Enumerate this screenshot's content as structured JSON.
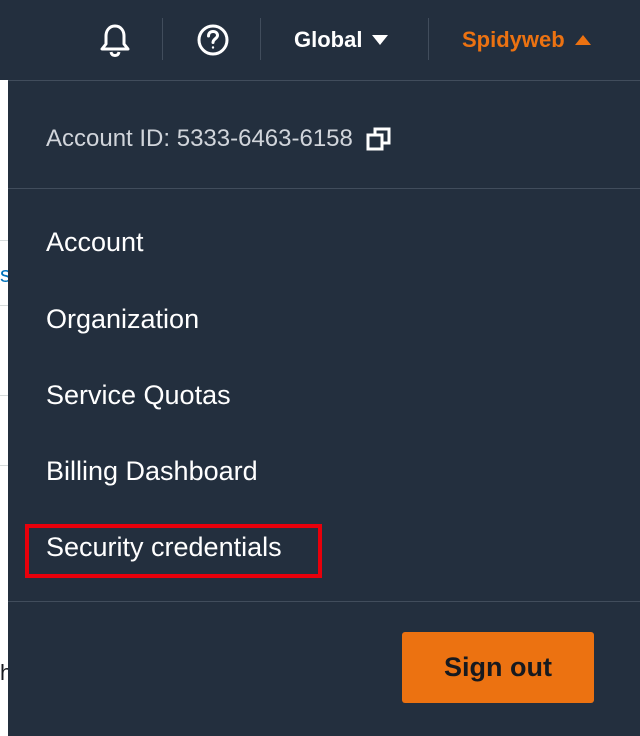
{
  "background": {
    "fragments": [
      "s",
      "h"
    ]
  },
  "topbar": {
    "icons": {
      "notifications": "bell-icon",
      "help": "help-circle-icon"
    },
    "region_label": "Global",
    "user_label": "Spidyweb",
    "colors": {
      "bar": "#232f3e",
      "user_accent": "#ec7211"
    }
  },
  "dropdown": {
    "account_id_label": "Account ID: 5333-6463-6158",
    "copy_icon": "copy-icon",
    "items": [
      {
        "label": "Account"
      },
      {
        "label": "Organization"
      },
      {
        "label": "Service Quotas"
      },
      {
        "label": "Billing Dashboard"
      },
      {
        "label": "Security credentials",
        "highlighted": true
      }
    ],
    "highlight_color": "#e8000b",
    "sign_out_label": "Sign out",
    "sign_out_color": "#ec7211"
  }
}
